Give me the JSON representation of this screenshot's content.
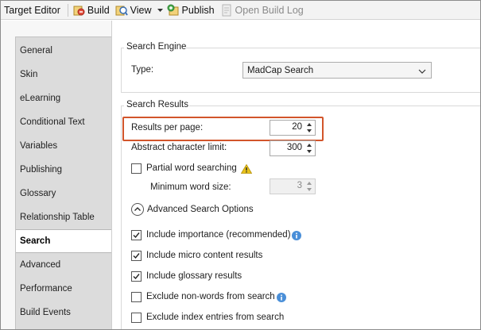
{
  "toolbar": {
    "title": "Target Editor",
    "build_label": "Build",
    "view_label": "View",
    "publish_label": "Publish",
    "open_build_log_label": "Open Build Log"
  },
  "sidebar": {
    "items": [
      {
        "label": "General"
      },
      {
        "label": "Skin"
      },
      {
        "label": "eLearning"
      },
      {
        "label": "Conditional Text"
      },
      {
        "label": "Variables"
      },
      {
        "label": "Publishing"
      },
      {
        "label": "Glossary"
      },
      {
        "label": "Relationship Table"
      },
      {
        "label": "Search",
        "active": true
      },
      {
        "label": "Advanced"
      },
      {
        "label": "Performance"
      },
      {
        "label": "Build Events"
      }
    ]
  },
  "search_engine": {
    "group_title": "Search Engine",
    "type_label": "Type:",
    "type_value": "MadCap Search"
  },
  "search_results": {
    "group_title": "Search Results",
    "results_per_page_label": "Results per page:",
    "results_per_page_value": "20",
    "abstract_limit_label": "Abstract character limit:",
    "abstract_limit_value": "300",
    "partial_word_label": "Partial word searching",
    "partial_word_checked": false,
    "min_word_size_label": "Minimum word size:",
    "min_word_size_value": "3",
    "advanced_options_label": "Advanced Search Options",
    "options": [
      {
        "label": "Include importance (recommended)",
        "checked": true,
        "info": true
      },
      {
        "label": "Include micro content results",
        "checked": true,
        "info": false
      },
      {
        "label": "Include glossary results",
        "checked": true,
        "info": false
      },
      {
        "label": "Exclude non-words from search",
        "checked": false,
        "info": true
      },
      {
        "label": "Exclude index entries from search",
        "checked": false,
        "info": false
      }
    ]
  },
  "colors": {
    "highlight": "#d2552b",
    "info": "#4a8fd8",
    "warning": "#e8c21a"
  }
}
